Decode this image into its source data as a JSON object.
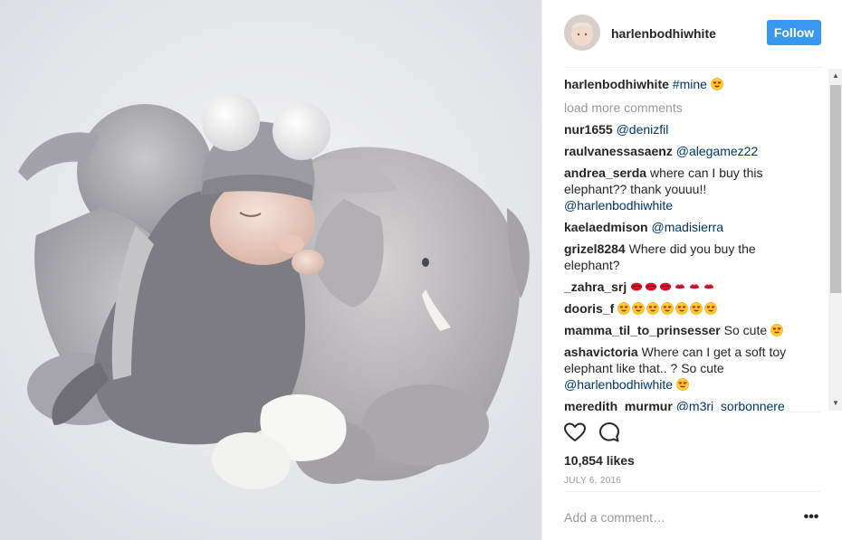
{
  "post": {
    "username": "harlenbodhiwhite",
    "follow_label": "Follow",
    "caption": {
      "user": "harlenbodhiwhite",
      "hashtag": "#mine",
      "emoji": "heart-eyes"
    },
    "load_more": "load more comments",
    "comments": [
      {
        "user": "nur1655",
        "text": "",
        "mention": "@denizfil",
        "tail": "",
        "emojis": []
      },
      {
        "user": "raulvanessasaenz",
        "text": "",
        "mention": "@alegamez22",
        "tail": "",
        "emojis": []
      },
      {
        "user": "andrea_serda",
        "text": "where can I buy this elephant?? thank youuu!!",
        "mention": "@harlenbodhiwhite",
        "tail": "",
        "emojis": []
      },
      {
        "user": "kaelaedmison",
        "text": "",
        "mention": "@madisierra",
        "tail": "",
        "emojis": []
      },
      {
        "user": "grizel8284",
        "text": "Where did you buy the elephant?",
        "mention": "",
        "tail": "",
        "emojis": []
      },
      {
        "user": "_zahra_srj",
        "text": "",
        "mention": "",
        "tail": "",
        "emojis": [
          "kiss-lips",
          "kiss-lips",
          "kiss-lips",
          "kiss-mark",
          "kiss-mark",
          "kiss-mark"
        ]
      },
      {
        "user": "dooris_f",
        "text": "",
        "mention": "",
        "tail": "",
        "emojis": [
          "heart-eyes",
          "heart-eyes",
          "heart-eyes",
          "heart-eyes",
          "heart-eyes",
          "heart-eyes",
          "heart-eyes"
        ]
      },
      {
        "user": "mamma_til_to_prinsesser",
        "text": "So cute",
        "mention": "",
        "tail": "",
        "emojis": [
          "heart-eyes"
        ]
      },
      {
        "user": "ashavictoria",
        "text": "Where can I get a soft toy elephant like that.. ? So cute",
        "mention": "@harlenbodhiwhite",
        "tail": "",
        "emojis": [
          "heart-eyes"
        ]
      },
      {
        "user": "meredith_murmur",
        "text": "",
        "mention": "@m3ri_sorbonnere",
        "tail": "",
        "emojis": []
      }
    ],
    "likes": "10,854 likes",
    "date": "JULY 6, 2016",
    "add_comment_placeholder": "Add a comment…",
    "more_options": "•••"
  },
  "icons": {
    "like": "heart-outline-icon",
    "comment": "speech-bubble-icon",
    "options": "ellipsis-icon"
  },
  "colors": {
    "follow": "#3897f0",
    "link": "#003569",
    "muted": "#999999",
    "text": "#262626"
  }
}
